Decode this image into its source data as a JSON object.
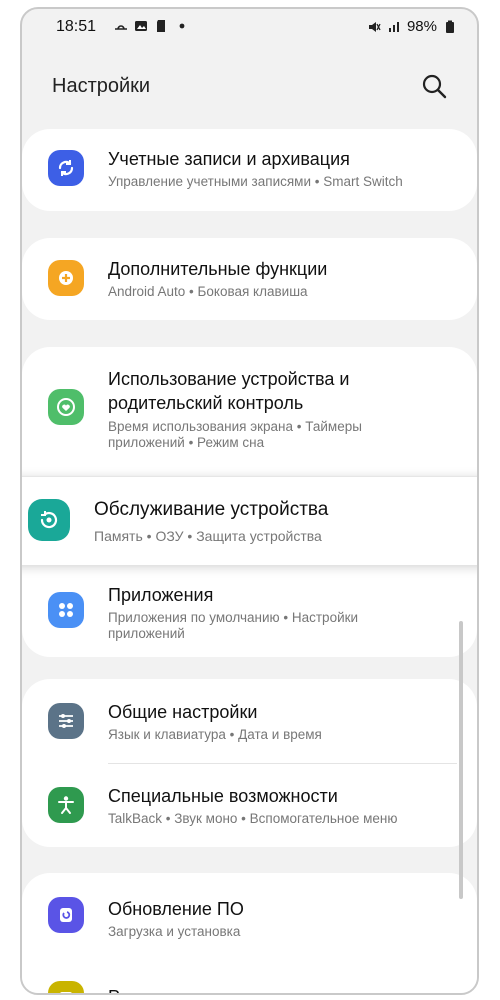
{
  "status_bar": {
    "time": "18:51",
    "battery": "98%",
    "icons": [
      "weather-icon",
      "gallery-icon",
      "sd-card-icon",
      "dot-icon",
      "mute-icon",
      "signal-icon",
      "battery-icon"
    ]
  },
  "header": {
    "title": "Настройки",
    "search_icon": "search-icon"
  },
  "items": [
    {
      "title": "Учетные записи и архивация",
      "subtitle": "Управление учетными записями • Smart Switch",
      "icon": "sync-icon",
      "color": "#3d5fe6"
    },
    {
      "title": "Дополнительные функции",
      "subtitle": "Android Auto • Боковая клавиша",
      "icon": "plus-gear-icon",
      "color": "#f5a623"
    },
    {
      "title_line1": "Использование устройства и",
      "title_line2": "родительский контроль",
      "subtitle_line1": "Время использования экрана • Таймеры",
      "subtitle_line2": "приложений • Режим сна",
      "icon": "digital-wellbeing-icon",
      "color": "#4fbe6a"
    },
    {
      "title": "Обслуживание устройства",
      "subtitle": "Память • ОЗУ • Защита устройства",
      "icon": "device-care-icon",
      "color": "#1aa898"
    },
    {
      "title": "Приложения",
      "subtitle_line1": "Приложения по умолчанию • Настройки",
      "subtitle_line2": "приложений",
      "icon": "apps-icon",
      "color": "#4a90f5"
    },
    {
      "title": "Общие настройки",
      "subtitle": "Язык и клавиатура • Дата и время",
      "icon": "sliders-icon",
      "color": "#5b7388"
    },
    {
      "title": "Специальные возможности",
      "subtitle": "TalkBack • Звук моно • Вспомогательное меню",
      "icon": "accessibility-icon",
      "color": "#2f9a4f"
    },
    {
      "title": "Обновление ПО",
      "subtitle": "Загрузка и установка",
      "icon": "update-icon",
      "color": "#5a54e6"
    },
    {
      "title": "Руководство пользователя",
      "icon": "manual-icon",
      "color": "#c9b400"
    }
  ]
}
